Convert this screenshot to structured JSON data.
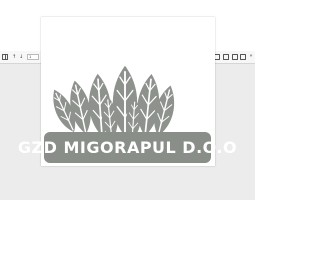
{
  "toolbar": {
    "page_number": "1",
    "page_total": "/ 1",
    "zoom": "100%"
  },
  "document": {
    "company_name": "GZD MIGORAPUL D.O.O"
  },
  "colors": {
    "viewer_background": "#ececec",
    "banner": "#8a8e89",
    "leaf_fill": "#8e928d",
    "leaf_vein": "#ffffff"
  },
  "icons": [
    "sidebar-icon",
    "arrow-up-icon",
    "arrow-down-icon",
    "minus-icon",
    "plus-icon",
    "presentation-icon",
    "open-file-icon",
    "print-icon",
    "download-icon",
    "more-icon"
  ]
}
